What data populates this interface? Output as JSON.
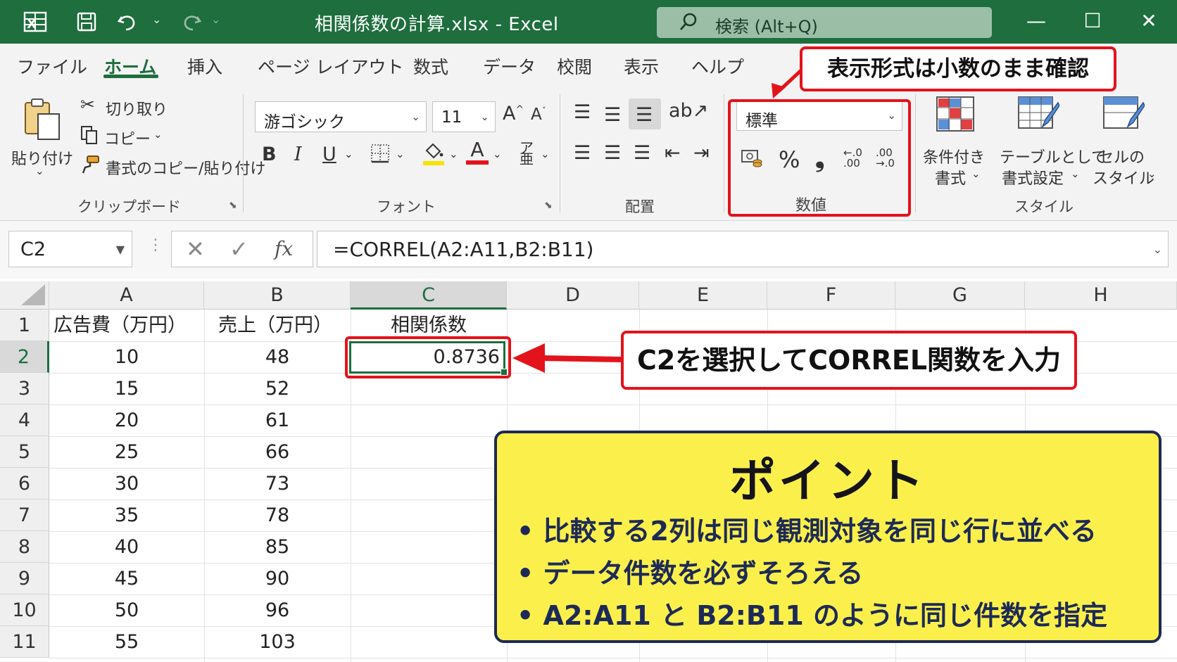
{
  "title_bar": {
    "excel_icon": "excel-logo-icon",
    "save_icon": "save-icon",
    "undo_icon": "undo-icon",
    "redo_icon": "redo-icon",
    "file_title": "相関係数の計算.xlsx  -  Excel",
    "search_placeholder": "検索 (Alt+Q)"
  },
  "tabs": [
    "ファイル",
    "ホーム",
    "挿入",
    "ページ レイアウト",
    "数式",
    "データ",
    "校閲",
    "表示",
    "ヘルプ"
  ],
  "active_tab": "ホーム",
  "ribbon": {
    "clipboard": {
      "paste": "貼り付け",
      "cut": "切り取り",
      "copy": "コピー",
      "format_painter": "書式のコピー/貼り付け",
      "group_label": "クリップボード"
    },
    "font": {
      "font_name": "游ゴシック",
      "font_size": "11",
      "bold": "B",
      "italic": "I",
      "underline": "U",
      "font_color_letter": "A",
      "grow": "A",
      "shrink": "A",
      "group_label": "フォント"
    },
    "alignment": {
      "group_label": "配置"
    },
    "number": {
      "format": "標準",
      "percent": "%",
      "comma": "❟",
      "group_label": "数値"
    },
    "styles": {
      "conditional": [
        "条件付き",
        "書式"
      ],
      "table": [
        "テーブルとして",
        "書式設定"
      ],
      "cell_styles": [
        "セルの",
        "スタイル"
      ],
      "group_label": "スタイル"
    }
  },
  "formula_bar": {
    "name_box": "C2",
    "fx": "fx",
    "formula": "=CORREL(A2:A11,B2:B11)"
  },
  "sheet": {
    "columns": [
      "A",
      "B",
      "C",
      "D",
      "E",
      "F",
      "G",
      "H"
    ],
    "selected_column": "C",
    "rows": [
      "1",
      "2",
      "3",
      "4",
      "5",
      "6",
      "7",
      "8",
      "9",
      "10",
      "11"
    ],
    "selected_row": "2",
    "headers": {
      "A1": "広告費（万円）",
      "B1": "売上（万円）",
      "C1": "相関係数"
    },
    "ad_cost": [
      "10",
      "15",
      "20",
      "25",
      "30",
      "35",
      "40",
      "45",
      "50",
      "55"
    ],
    "sales": [
      "48",
      "52",
      "61",
      "66",
      "73",
      "78",
      "85",
      "90",
      "96",
      "103"
    ],
    "c2_value": "0.8736"
  },
  "annotations": {
    "number_format_callout": "表示形式は小数のまま確認",
    "c2_callout": "C2を選択してCORREL関数を入力",
    "point_title": "ポイント",
    "point_items": [
      "比較する2列は同じ観測対象を同じ行に並べる",
      "データ件数を必ずそろえる",
      "A2:A11 と B2:B11 のように同じ件数を指定"
    ],
    "accent_color": "#e3131b",
    "point_bg": "#fbf04b",
    "excel_green": "#1e6e3e"
  }
}
